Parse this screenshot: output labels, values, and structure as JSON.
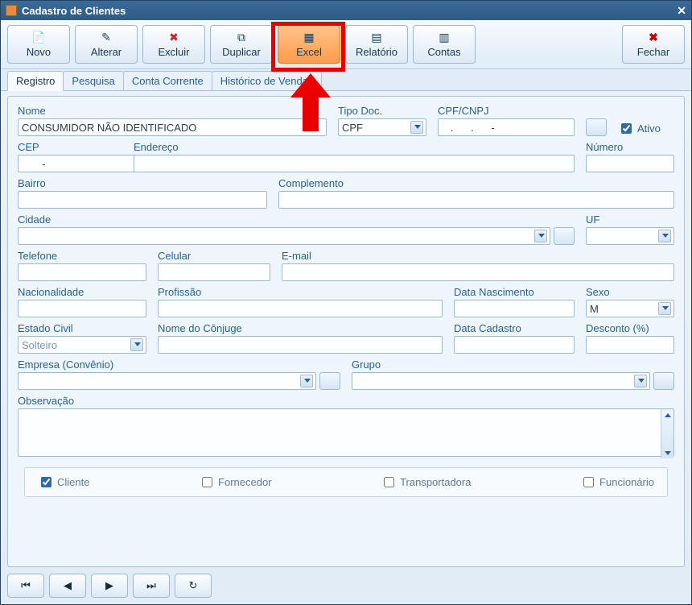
{
  "window": {
    "title": "Cadastro de Clientes"
  },
  "toolbar": {
    "novo": "Novo",
    "alterar": "Alterar",
    "excluir": "Excluir",
    "duplicar": "Duplicar",
    "excel": "Excel",
    "relatorio": "Relatório",
    "contas": "Contas",
    "fechar": "Fechar"
  },
  "tabs": {
    "registro": "Registro",
    "pesquisa": "Pesquisa",
    "conta_corrente": "Conta Corrente",
    "historico_vendas": "Histórico de Vendas"
  },
  "labels": {
    "nome": "Nome",
    "tipo_doc": "Tipo Doc.",
    "cpf_cnpj": "CPF/CNPJ",
    "ativo": "Ativo",
    "cep": "CEP",
    "endereco": "Endereço",
    "numero": "Número",
    "bairro": "Bairro",
    "complemento": "Complemento",
    "cidade": "Cidade",
    "uf": "UF",
    "telefone": "Telefone",
    "celular": "Celular",
    "email": "E-mail",
    "nacionalidade": "Nacionalidade",
    "profissao": "Profissão",
    "data_nascimento": "Data Nascimento",
    "sexo": "Sexo",
    "estado_civil": "Estado Civil",
    "nome_conjuge": "Nome do Cônjuge",
    "data_cadastro": "Data Cadastro",
    "desconto": "Desconto (%)",
    "empresa": "Empresa (Convênio)",
    "grupo": "Grupo",
    "observacao": "Observação"
  },
  "values": {
    "nome": "CONSUMIDOR NÃO IDENTIFICADO",
    "tipo_doc": "CPF",
    "cpf_cnpj": "   .      .      -",
    "cep": "       -",
    "sexo": "M",
    "estado_civil": "Solteiro",
    "ativo_checked": true,
    "cliente_checked": true,
    "fornecedor_checked": false,
    "transportadora_checked": false,
    "funcionario_checked": false
  },
  "flags": {
    "cliente": "Cliente",
    "fornecedor": "Fornecedor",
    "transportadora": "Transportadora",
    "funcionario": "Funcionário"
  },
  "icons": {
    "novo": "document-new-icon",
    "alterar": "edit-icon",
    "excluir": "delete-icon",
    "duplicar": "copy-icon",
    "excel": "excel-icon",
    "relatorio": "report-icon",
    "contas": "accounts-icon",
    "fechar": "close-x-icon"
  },
  "colors": {
    "highlight_border": "#e80000",
    "accent": "#2b5f8f",
    "toolbar_highlight": "#ff9b4a"
  }
}
